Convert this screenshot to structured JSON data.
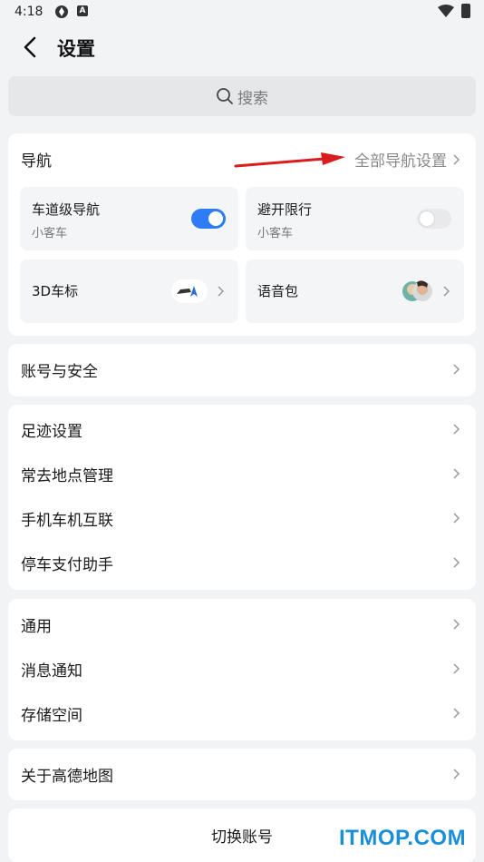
{
  "status_bar": {
    "time": "4:18",
    "app_badge": "A"
  },
  "header": {
    "title": "设置"
  },
  "search": {
    "placeholder": "搜索"
  },
  "navigation": {
    "heading": "导航",
    "all_settings": "全部导航设置",
    "tiles": [
      {
        "title": "车道级导航",
        "subtitle": "小客车",
        "toggle_on": true
      },
      {
        "title": "避开限行",
        "subtitle": "小客车",
        "toggle_on": false
      },
      {
        "title": "3D车标"
      },
      {
        "title": "语音包"
      }
    ]
  },
  "account": {
    "label": "账号与安全"
  },
  "group2": {
    "items": [
      "足迹设置",
      "常去地点管理",
      "手机车机互联",
      "停车支付助手"
    ]
  },
  "group3": {
    "items": [
      "通用",
      "消息通知",
      "存储空间"
    ]
  },
  "about": {
    "label": "关于高德地图"
  },
  "switch_account": {
    "label": "切换账号"
  },
  "watermark": {
    "text": "ITMOP.COM"
  },
  "colors": {
    "accent": "#2e7cf6",
    "arrow": "#d91c1c",
    "watermark": "#1a8fd8"
  }
}
